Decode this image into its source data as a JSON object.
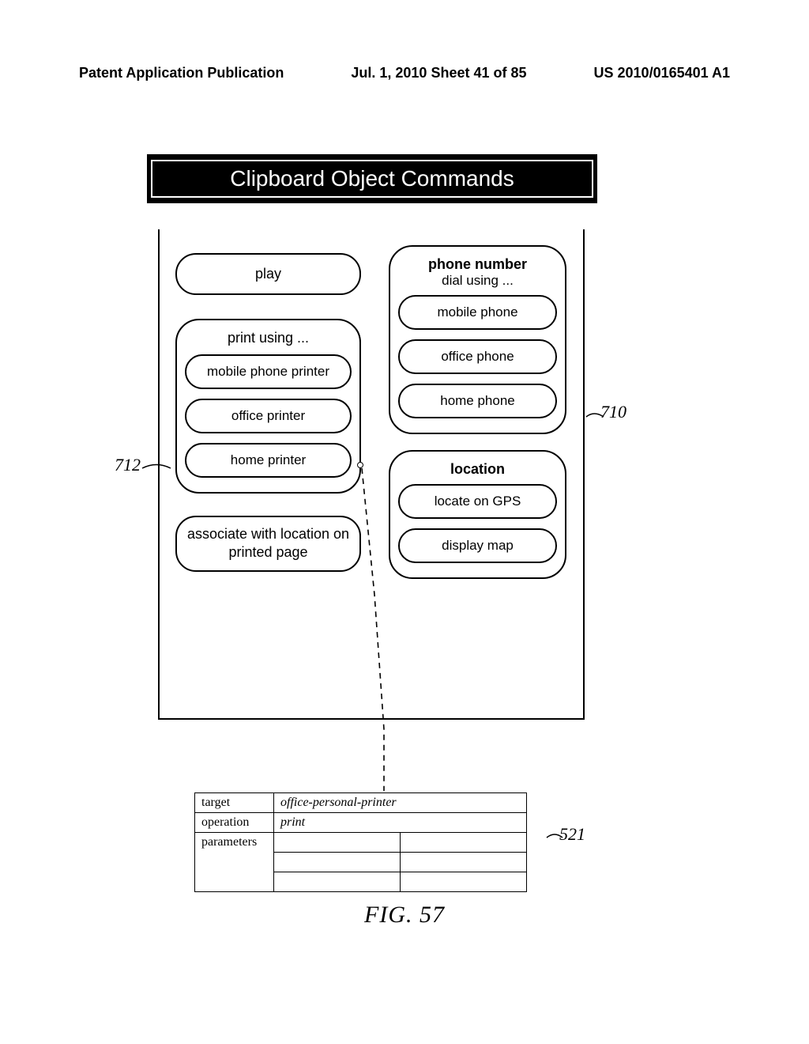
{
  "header": {
    "left": "Patent Application Publication",
    "center": "Jul. 1, 2010   Sheet 41 of 85",
    "right": "US 2010/0165401 A1"
  },
  "banner": {
    "title": "Clipboard Object Commands"
  },
  "left_col": {
    "play": "play",
    "print_group_label": "print using ...",
    "print_opts": {
      "mobile": "mobile phone printer",
      "office": "office printer",
      "home": "home printer"
    },
    "assoc": "associate with location on printed page"
  },
  "right_col": {
    "phone_group": {
      "title": "phone number",
      "sub": "dial using ...",
      "opts": {
        "mobile": "mobile phone",
        "office": "office phone",
        "home": "home phone"
      }
    },
    "location_group": {
      "title": "location",
      "opts": {
        "gps": "locate on GPS",
        "map": "display map"
      }
    }
  },
  "refs": {
    "r712": "712",
    "r710": "710",
    "r521": "521"
  },
  "table": {
    "rows": {
      "target": {
        "k": "target",
        "v": "office-personal-printer"
      },
      "operation": {
        "k": "operation",
        "v": "print"
      },
      "parameters": {
        "k": "parameters"
      }
    }
  },
  "figure_label": "FIG. 57"
}
